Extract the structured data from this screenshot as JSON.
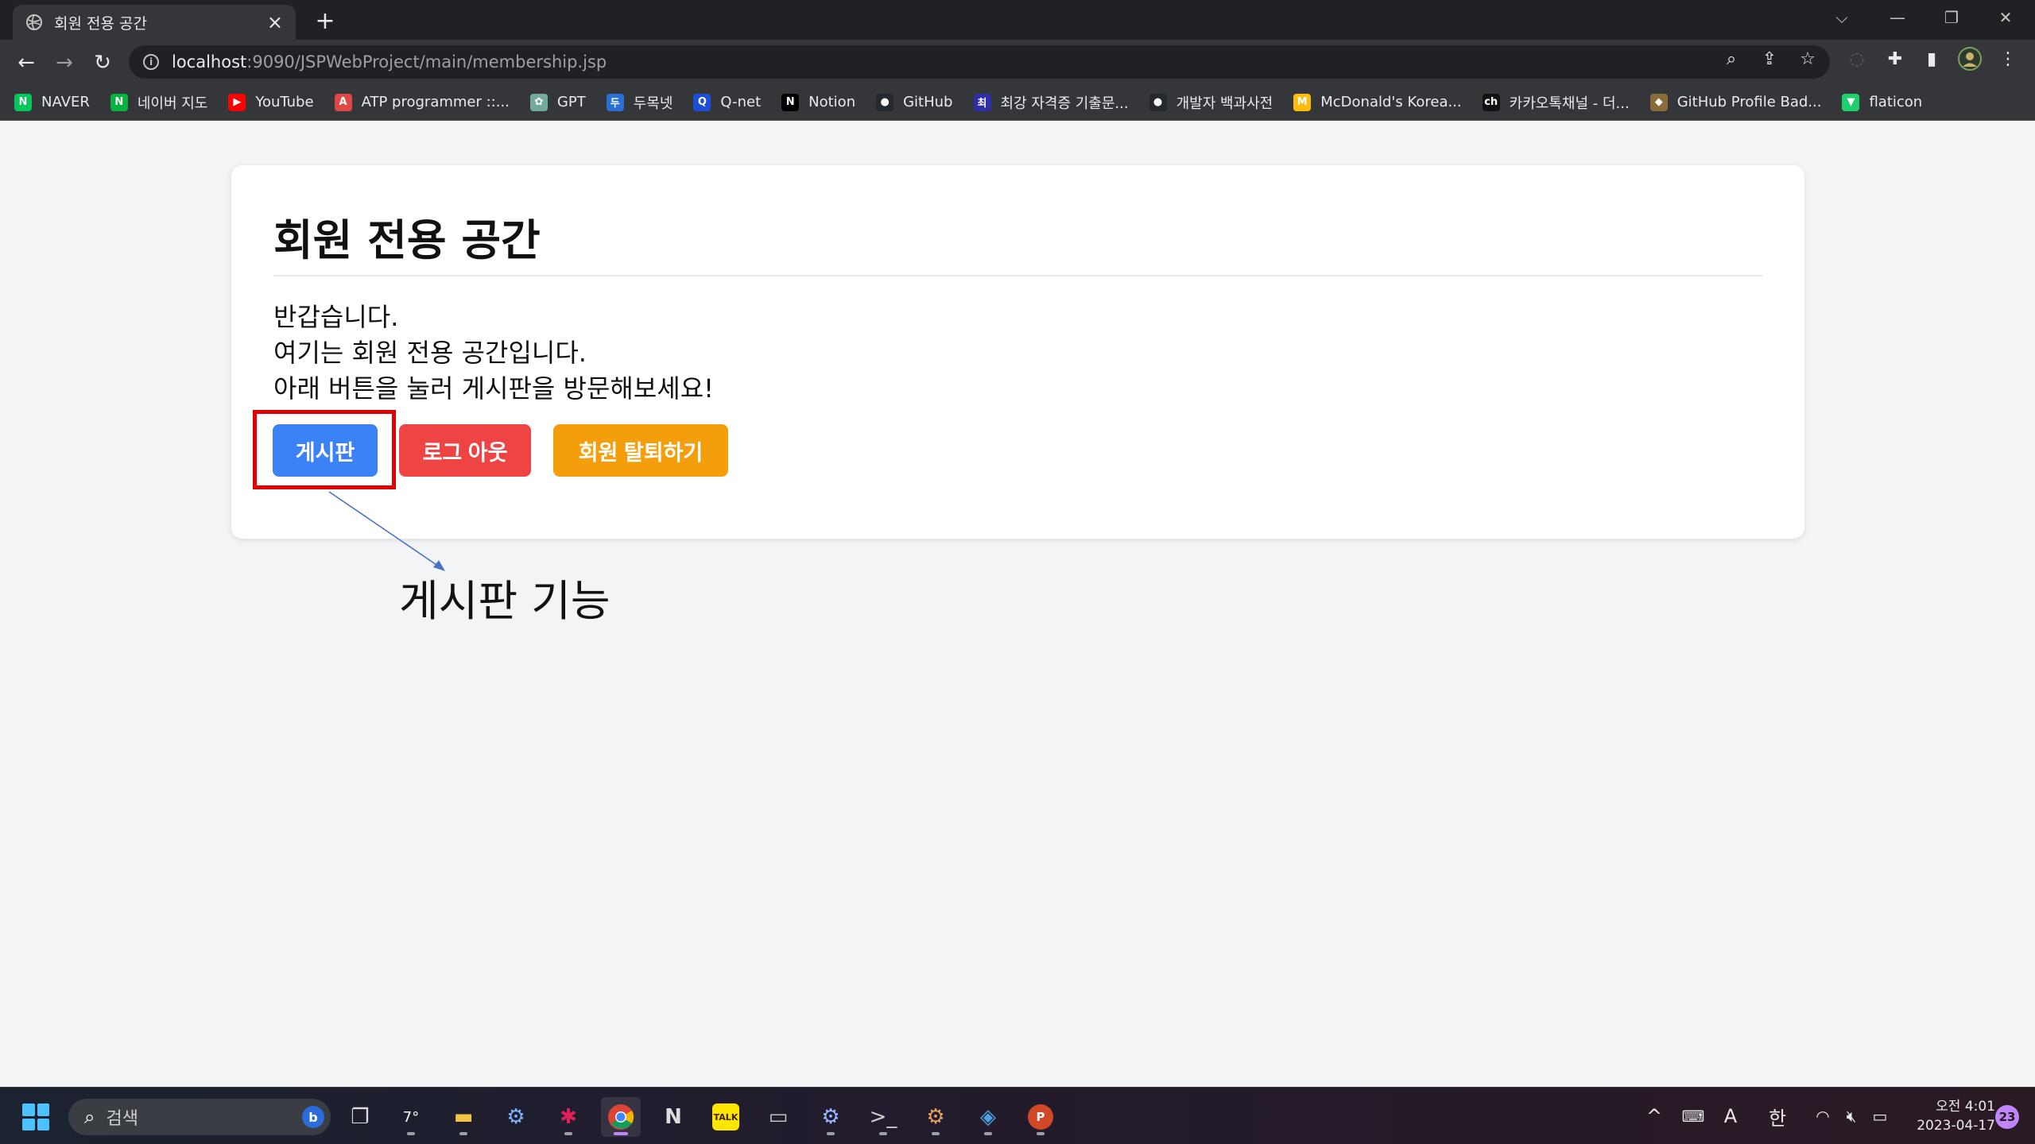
{
  "browser": {
    "tab_title": "회원 전용 공간",
    "url_host": "localhost",
    "url_rest": ":9090/JSPWebProject/main/membership.jsp"
  },
  "bookmarks": [
    {
      "label": "NAVER",
      "icon": "N",
      "color": "#03c75a"
    },
    {
      "label": "네이버 지도",
      "icon": "N",
      "color": "#06b33f"
    },
    {
      "label": "YouTube",
      "icon": "▶",
      "color": "#ff0000"
    },
    {
      "label": "ATP programmer ::...",
      "icon": "A",
      "color": "#e04848"
    },
    {
      "label": "GPT",
      "icon": "✿",
      "color": "#74aa9c"
    },
    {
      "label": "두목넷",
      "icon": "두",
      "color": "#2a6fd6"
    },
    {
      "label": "Q-net",
      "icon": "Q",
      "color": "#1d4ed8"
    },
    {
      "label": "Notion",
      "icon": "N",
      "color": "#000000"
    },
    {
      "label": "GitHub",
      "icon": "●",
      "color": "#24292f"
    },
    {
      "label": "최강 자격증 기출문...",
      "icon": "최",
      "color": "#2e2ea8"
    },
    {
      "label": "개발자 백과사전",
      "icon": "●",
      "color": "#24292f"
    },
    {
      "label": "McDonald's Korea...",
      "icon": "M",
      "color": "#ffbc0d"
    },
    {
      "label": "카카오톡채널 - 더...",
      "icon": "ch",
      "color": "#111111"
    },
    {
      "label": "GitHub Profile Bad...",
      "icon": "◆",
      "color": "#8b6b3a"
    },
    {
      "label": "flaticon",
      "icon": "▼",
      "color": "#1fce6d"
    }
  ],
  "page": {
    "heading": "회원 전용 공간",
    "lines": [
      "반갑습니다.",
      "여기는 회원 전용 공간입니다.",
      "아래 버튼을 눌러 게시판을 방문해보세요!"
    ],
    "buttons": {
      "board": "게시판",
      "logout": "로그 아웃",
      "withdraw": "회원 탈퇴하기"
    },
    "annotation": "게시판 기능"
  },
  "taskbar": {
    "search_label": "검색",
    "bing": "b",
    "weather": "7°",
    "ime_a": "A",
    "ime_han": "한",
    "time": "오전 4:01",
    "date": "2023-04-17",
    "notifications": "23"
  },
  "colors": {
    "board_button": "#3b82f6",
    "logout_button": "#ef4444",
    "withdraw_button": "#f59e0b",
    "highlight": "#e00000"
  }
}
